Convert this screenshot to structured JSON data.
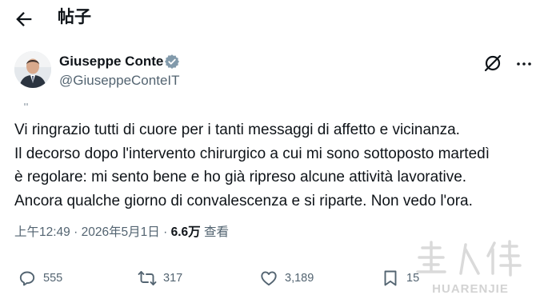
{
  "header": {
    "title": "帖子",
    "back_icon": "arrow-left-icon"
  },
  "author": {
    "name": "Giuseppe Conte",
    "handle": "@GiuseppeConteIT",
    "verified_color": "#829aab"
  },
  "post": {
    "lines": [
      "Vi ringrazio tutti di cuore per i tanti messaggi di affetto e vicinanza.",
      "Il decorso dopo l'intervento chirurgico a cui mi sono sottoposto martedì",
      "è regolare: mi sento bene e ho già ripreso alcune attività lavorative.",
      "Ancora qualche giorno di convalescenza e si riparte. Non vedo l'ora."
    ]
  },
  "meta": {
    "time": "上午12:49",
    "separator": " · ",
    "date": "2026年5月1日",
    "views_count": "6.6万",
    "views_label": "查看"
  },
  "actions": {
    "replies": "555",
    "reposts": "317",
    "likes": "3,189",
    "bookmarks": "15"
  },
  "watermark": {
    "text": "HUARENJIE"
  },
  "colors": {
    "text": "#0f1419",
    "secondary": "#536471"
  }
}
